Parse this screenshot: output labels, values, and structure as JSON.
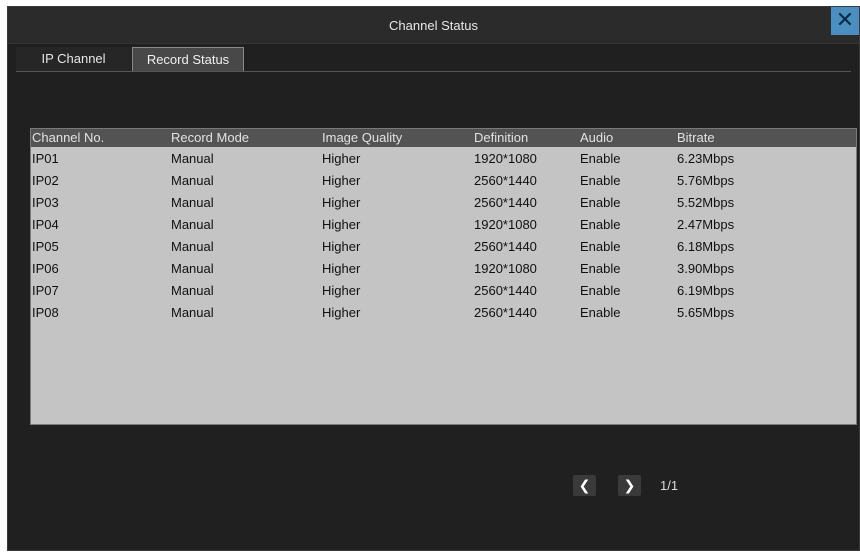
{
  "window": {
    "title": "Channel Status",
    "close_glyph": "✕"
  },
  "tabs": [
    {
      "label": "IP Channel",
      "selected": false
    },
    {
      "label": "Record Status",
      "selected": true
    }
  ],
  "table": {
    "columns": [
      "Channel No.",
      "Record Mode",
      "Image Quality",
      "Definition",
      "Audio",
      "Bitrate"
    ],
    "rows": [
      [
        "IP01",
        "Manual",
        "Higher",
        "1920*1080",
        "Enable",
        "6.23Mbps"
      ],
      [
        "IP02",
        "Manual",
        "Higher",
        "2560*1440",
        "Enable",
        "5.76Mbps"
      ],
      [
        "IP03",
        "Manual",
        "Higher",
        "2560*1440",
        "Enable",
        "5.52Mbps"
      ],
      [
        "IP04",
        "Manual",
        "Higher",
        "1920*1080",
        "Enable",
        "2.47Mbps"
      ],
      [
        "IP05",
        "Manual",
        "Higher",
        "2560*1440",
        "Enable",
        "6.18Mbps"
      ],
      [
        "IP06",
        "Manual",
        "Higher",
        "1920*1080",
        "Enable",
        "3.90Mbps"
      ],
      [
        "IP07",
        "Manual",
        "Higher",
        "2560*1440",
        "Enable",
        "6.19Mbps"
      ],
      [
        "IP08",
        "Manual",
        "Higher",
        "2560*1440",
        "Enable",
        "5.65Mbps"
      ]
    ]
  },
  "pager": {
    "prev_glyph": "❮",
    "next_glyph": "❯",
    "page_text": "1/1"
  }
}
